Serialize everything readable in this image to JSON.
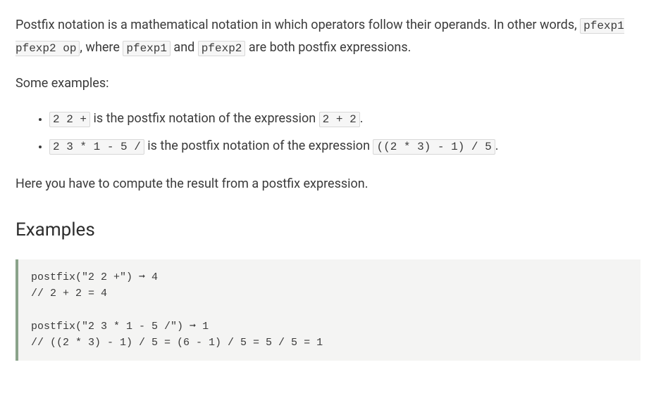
{
  "intro": {
    "part1": "Postfix notation is a mathematical notation in which operators follow their operands. In other words, ",
    "code1": "pfexp1 pfexp2 op",
    "part2": ", where ",
    "code2": "pfexp1",
    "part3": " and ",
    "code3": "pfexp2",
    "part4": " are both postfix expressions."
  },
  "some_examples_label": "Some examples:",
  "bullets": [
    {
      "code_a": "2 2 +",
      "mid": " is the postfix notation of the expression ",
      "code_b": "2 + 2",
      "tail": "."
    },
    {
      "code_a": "2 3 * 1 - 5 /",
      "mid": " is the postfix notation of the expression ",
      "code_b": "((2 * 3) - 1) / 5",
      "tail": "."
    }
  ],
  "task_line": "Here you have to compute the result from a postfix expression.",
  "examples_heading": "Examples",
  "codeblock": "postfix(\"2 2 +\") ➞ 4\n// 2 + 2 = 4\n\npostfix(\"2 3 * 1 - 5 /\") ➞ 1\n// ((2 * 3) - 1) / 5 = (6 - 1) / 5 = 5 / 5 = 1"
}
